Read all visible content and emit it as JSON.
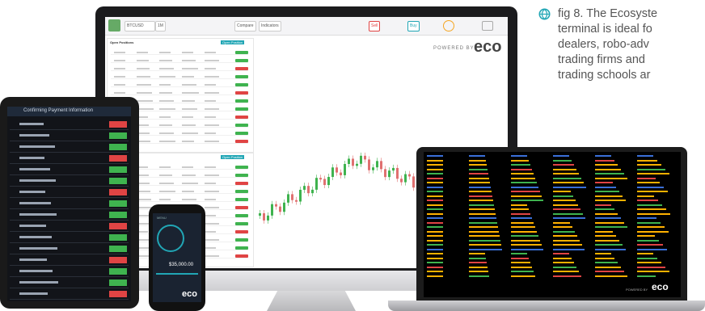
{
  "caption": {
    "lines": [
      "fig 8. The Ecosyste",
      "terminal is ideal fo",
      "dealers, robo-adv",
      "trading firms and",
      "trading schools ar"
    ],
    "icon": "globe-icon"
  },
  "monitor": {
    "symbol": "BTCUSD",
    "interval": "1M",
    "indicators_label": "Indicators",
    "compare_label": "Compare",
    "sell_label": "Sell",
    "buy_label": "Buy",
    "brand": "POWERED BY",
    "brand_logo": "eco",
    "open_positions_title": "Open Positions",
    "new_position_label": "Open Position",
    "columns": [
      "Pair",
      "Buying Price",
      "Buy Price",
      "Volume",
      "Profit",
      "Risk",
      "Age",
      "Action"
    ],
    "position_rows": 12,
    "close_label": "SELL POSITION"
  },
  "tablet": {
    "title": "Confirming Payment Information",
    "rows": 16
  },
  "phone": {
    "logo": "eco",
    "balance": "$35,000.00",
    "menu_label": "MENU"
  },
  "laptop": {
    "brand": "POWERED BY",
    "brand_logo": "eco"
  },
  "colors": {
    "green": "#3fb34f",
    "red": "#e04444",
    "amber": "#ffb100",
    "brand_teal": "#21a6b5"
  }
}
